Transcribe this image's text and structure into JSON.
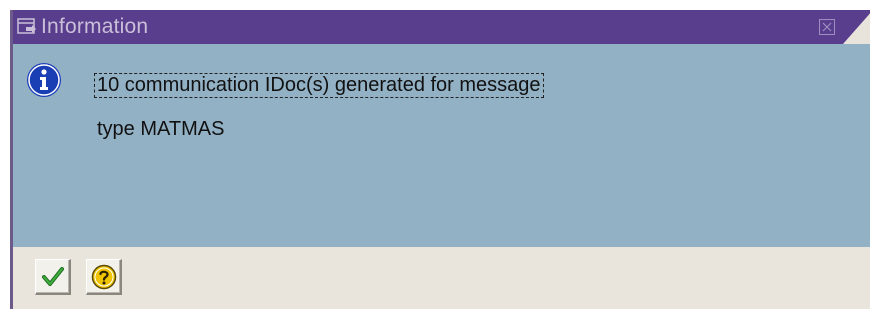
{
  "dialog": {
    "title": "Information",
    "title_icon": "window-icon",
    "close_icon": "close-icon"
  },
  "message": {
    "icon": "info-icon",
    "line1": "10 communication IDoc(s) generated for message",
    "line2": "type MATMAS"
  },
  "buttons": [
    {
      "icon": "checkmark-icon",
      "color": "#2e8b2e"
    },
    {
      "icon": "help-icon",
      "color": "#f0c400"
    }
  ],
  "colors": {
    "titlebar": "#5a3e8e",
    "content": "#93b1c4",
    "footer": "#e9e5dd",
    "info_blue": "#1a3fb5"
  }
}
